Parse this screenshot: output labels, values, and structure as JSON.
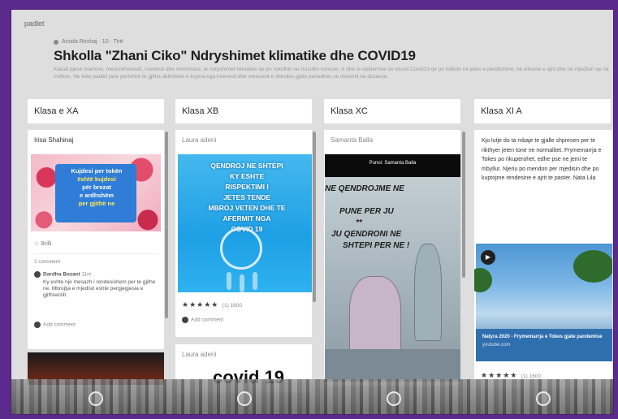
{
  "app": {
    "logo": "padlet"
  },
  "header": {
    "author_meta": "Arsida Rexhaj · 10 · Tirë",
    "title": "Shkolla \"Zhani Ciko\" Ndryshimet klimatike dhe COVID19",
    "description": "Klasat pjese marrese, mesimdhenesit, nxenesit dhe shkrimtare, te ndryshimet klimatike qe po ndodhin ne rruzullin tokesor, si dhe te epidemise se virusit Covid19 qe po ndikon ne jeten e perditshme, ne cilesine e ajrit dhe ne mjedisin qe na rrethon. Ne kete padlet jane perfshire te gjitha aktivitetet e kryera nga nxenesit dhe mesuesit e shkolles gjate periudhes se mesimit ne distance."
  },
  "columns": [
    {
      "name": "Klasa e XA",
      "card": {
        "author": "Irisa Shahinaj",
        "image_text_lines": [
          "Kujdesi per tokën",
          "është kujdesi",
          "për brezat",
          "e ardhshëm",
          "per gjithë ne"
        ],
        "reaction": "☆ Brilli",
        "comments_label": "1 comment",
        "comment_author": "Dardha Bozani",
        "comment_time": "11m",
        "comment_text": "Ky eshte nje mesazh i rendesishem per te gjithe ne. Mbrojtja e mjedisit eshte pergjegjesia e gjithsecilit.",
        "add_comment": "Add comment"
      }
    },
    {
      "name": "Klasa XB",
      "card": {
        "author": "Laura adeni",
        "image_text_lines": [
          "QENDROJ NE SHTEPI",
          "KY ESHTE",
          "RISPEKTIMI I",
          "JETES TENDE",
          "MBROJ VETEN DHE TE",
          "AFERMIT NGA",
          "COVID 19"
        ],
        "stars": "★★★★★",
        "rating": "(1) 1600",
        "add_comment": "Add comment"
      },
      "card2": {
        "author": "Laura adeni",
        "image_text": "covid 19"
      }
    },
    {
      "name": "Klasa XC",
      "card": {
        "author": "Samanta Balla",
        "image_top": "Punoi: Samanta Balla",
        "image_text_lines": [
          "NE QENDROJME NE",
          "PUNE PER JU",
          "**",
          "JU QENDRONI NE",
          "SHTEPI PER NE !"
        ]
      }
    },
    {
      "name": "Klasa XI A",
      "card": {
        "text": "Kjo lutje do ta mbaje te gjalle shpresen per te rikthyer jeten tone ne normalitet. Frymemarrja e Tokes po rikuperohet, edhe pse ne jemi te mbyllur. Njeriu po mendon per mjedisin dhe po kuptojme rendesine e ajrit te paster. Nata Lila",
        "author": "Nata Lila",
        "video_caption": "Natyra 2020 - Frymemarrja e Tokes gjate pandemise",
        "video_source": "youtube.com",
        "stars": "★★★★★",
        "rating": "(1) 1600"
      }
    }
  ]
}
